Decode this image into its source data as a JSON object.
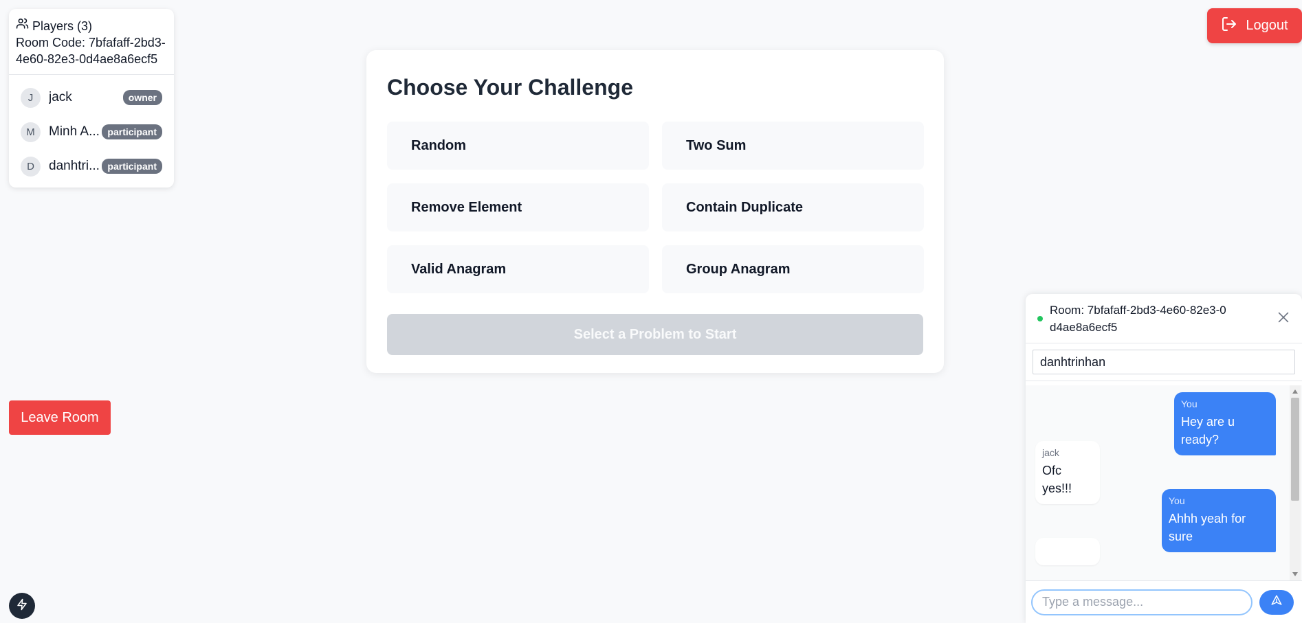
{
  "players_panel": {
    "title": "Players (3)",
    "room_code_line": "Room Code: 7bfafaff-2bd3-4e60-82e3-0d4ae8a6ecf5",
    "players": [
      {
        "initial": "J",
        "name": "jack",
        "role": "owner"
      },
      {
        "initial": "M",
        "name": "Minh A...",
        "role": "participant"
      },
      {
        "initial": "D",
        "name": "danhtri...",
        "role": "participant"
      }
    ]
  },
  "header": {
    "logout_label": "Logout"
  },
  "challenge": {
    "title": "Choose Your Challenge",
    "problems": [
      "Random",
      "Two Sum",
      "Remove Element",
      "Contain Duplicate",
      "Valid Anagram",
      "Group Anagram"
    ],
    "start_label": "Select a Problem to Start"
  },
  "leave_room_label": "Leave Room",
  "chat": {
    "room_title": "Room: 7bfafaff-2bd3-4e60-82e3-0d4ae8a6ecf5",
    "username": "danhtrinhan",
    "messages": [
      {
        "sender": "You",
        "text": "Hey are u ready?",
        "mine": true
      },
      {
        "sender": "jack",
        "text": "Ofc yes!!!",
        "mine": false
      },
      {
        "sender": "You",
        "text": "Ahhh yeah for sure",
        "mine": true
      }
    ],
    "input_placeholder": "Type a message..."
  },
  "colors": {
    "danger": "#ef4444",
    "primary": "#3b82f6",
    "online": "#22c55e"
  },
  "icons": {
    "players": "users-icon",
    "logout": "logout-icon",
    "close": "close-icon",
    "send": "send-icon",
    "bolt": "bolt-icon"
  }
}
